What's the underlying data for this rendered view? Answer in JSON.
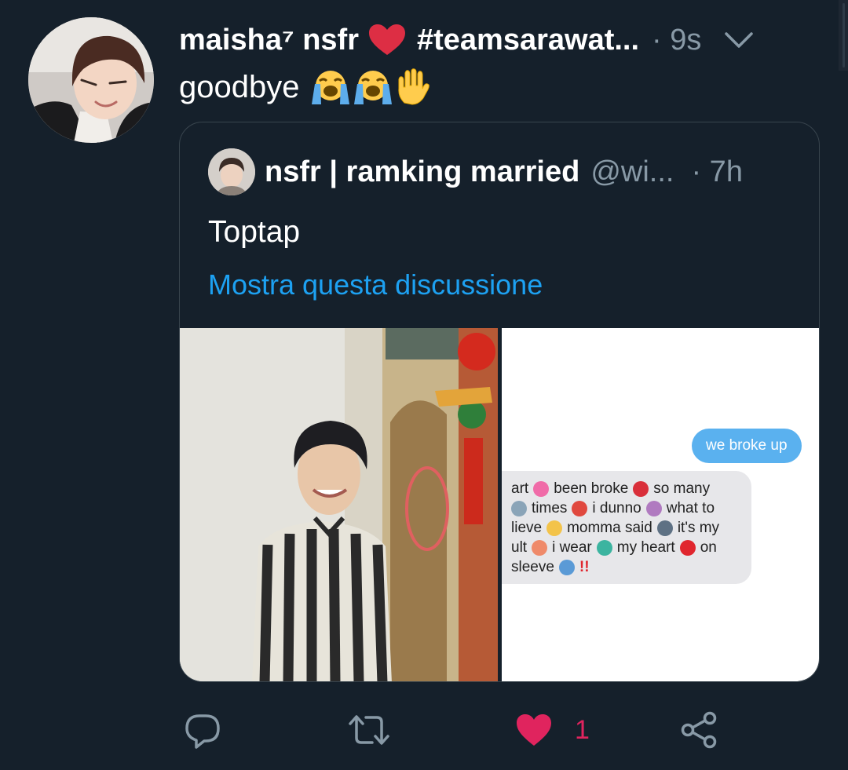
{
  "tweet": {
    "display_name": "maisha⁷ nsfr",
    "hashtag": "#teamsarawat...",
    "time": "· 9s",
    "text": "goodbye"
  },
  "quoted_tweet": {
    "display_name": "nsfr | ramking married",
    "handle": "@wi...",
    "time": "· 7h",
    "text": "Toptap",
    "thread_link": "Mostra questa discussione"
  },
  "screenshot_chat": {
    "sent_message": "we broke up",
    "received_lines": [
      "art",
      "been broke",
      "so many",
      "times",
      "i dunno",
      "what to",
      "lieve",
      "momma said",
      "it's my",
      "ult",
      "i wear",
      "my heart",
      "on",
      "sleeve",
      "!!"
    ]
  },
  "actions": {
    "like_count": "1"
  },
  "icons": {
    "heart": "heart-icon",
    "reply": "reply-icon",
    "retweet": "retweet-icon",
    "like": "like-icon",
    "share": "share-icon",
    "chevron": "chevron-down-icon"
  },
  "colors": {
    "background": "#15202b",
    "border": "#38444d",
    "muted_text": "#8899a6",
    "link": "#1da1f2",
    "like": "#e0245e"
  }
}
